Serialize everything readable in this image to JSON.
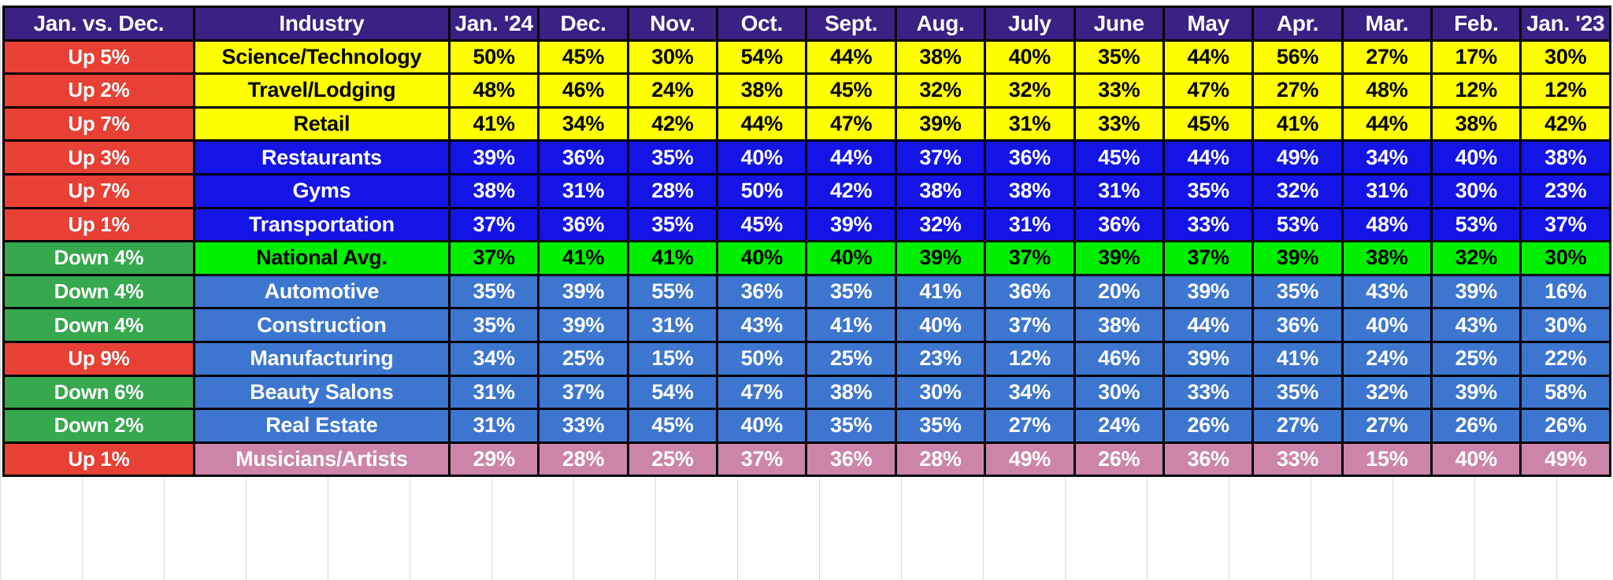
{
  "table": {
    "headers": {
      "change": "Jan. vs. Dec.",
      "industry": "Industry",
      "months": [
        "Jan. '24",
        "Dec.",
        "Nov.",
        "Oct.",
        "Sept.",
        "Aug.",
        "July",
        "June",
        "May",
        "Apr.",
        "Mar.",
        "Feb.",
        "Jan. '23"
      ]
    },
    "colors": {
      "header_bg": "#3b2183",
      "up_bg": "#e84034",
      "down_bg": "#36a94f",
      "band_yellow": "#ffff00",
      "band_blue": "#1414e6",
      "band_green": "#00f000",
      "band_steel": "#3d76d0",
      "band_pink": "#cc85a8"
    },
    "rows": [
      {
        "change": "Up 5%",
        "direction": "up",
        "industry": "Science/Technology",
        "band": "yellow",
        "values": [
          "50%",
          "45%",
          "30%",
          "54%",
          "44%",
          "38%",
          "40%",
          "35%",
          "44%",
          "56%",
          "27%",
          "17%",
          "30%"
        ]
      },
      {
        "change": "Up 2%",
        "direction": "up",
        "industry": "Travel/Lodging",
        "band": "yellow",
        "values": [
          "48%",
          "46%",
          "24%",
          "38%",
          "45%",
          "32%",
          "32%",
          "33%",
          "47%",
          "27%",
          "48%",
          "12%",
          "12%"
        ]
      },
      {
        "change": "Up 7%",
        "direction": "up",
        "industry": "Retail",
        "band": "yellow",
        "values": [
          "41%",
          "34%",
          "42%",
          "44%",
          "47%",
          "39%",
          "31%",
          "33%",
          "45%",
          "41%",
          "44%",
          "38%",
          "42%"
        ]
      },
      {
        "change": "Up 3%",
        "direction": "up",
        "industry": "Restaurants",
        "band": "blue",
        "values": [
          "39%",
          "36%",
          "35%",
          "40%",
          "44%",
          "37%",
          "36%",
          "45%",
          "44%",
          "49%",
          "34%",
          "40%",
          "38%"
        ]
      },
      {
        "change": "Up 7%",
        "direction": "up",
        "industry": "Gyms",
        "band": "blue",
        "values": [
          "38%",
          "31%",
          "28%",
          "50%",
          "42%",
          "38%",
          "38%",
          "31%",
          "35%",
          "32%",
          "31%",
          "30%",
          "23%"
        ]
      },
      {
        "change": "Up 1%",
        "direction": "up",
        "industry": "Transportation",
        "band": "blue",
        "values": [
          "37%",
          "36%",
          "35%",
          "45%",
          "39%",
          "32%",
          "31%",
          "36%",
          "33%",
          "53%",
          "48%",
          "53%",
          "37%"
        ]
      },
      {
        "change": "Down 4%",
        "direction": "down",
        "industry": "National Avg.",
        "band": "green",
        "values": [
          "37%",
          "41%",
          "41%",
          "40%",
          "40%",
          "39%",
          "37%",
          "39%",
          "37%",
          "39%",
          "38%",
          "32%",
          "30%"
        ]
      },
      {
        "change": "Down 4%",
        "direction": "down",
        "industry": "Automotive",
        "band": "steel",
        "values": [
          "35%",
          "39%",
          "55%",
          "36%",
          "35%",
          "41%",
          "36%",
          "20%",
          "39%",
          "35%",
          "43%",
          "39%",
          "16%"
        ]
      },
      {
        "change": "Down 4%",
        "direction": "down",
        "industry": "Construction",
        "band": "steel",
        "values": [
          "35%",
          "39%",
          "31%",
          "43%",
          "41%",
          "40%",
          "37%",
          "38%",
          "44%",
          "36%",
          "40%",
          "43%",
          "30%"
        ]
      },
      {
        "change": "Up 9%",
        "direction": "up",
        "industry": "Manufacturing",
        "band": "steel",
        "values": [
          "34%",
          "25%",
          "15%",
          "50%",
          "25%",
          "23%",
          "12%",
          "46%",
          "39%",
          "41%",
          "24%",
          "25%",
          "22%"
        ]
      },
      {
        "change": "Down 6%",
        "direction": "down",
        "industry": "Beauty Salons",
        "band": "steel",
        "values": [
          "31%",
          "37%",
          "54%",
          "47%",
          "38%",
          "30%",
          "34%",
          "30%",
          "33%",
          "35%",
          "32%",
          "39%",
          "58%"
        ]
      },
      {
        "change": "Down 2%",
        "direction": "down",
        "industry": "Real Estate",
        "band": "steel",
        "values": [
          "31%",
          "33%",
          "45%",
          "40%",
          "35%",
          "35%",
          "27%",
          "24%",
          "26%",
          "27%",
          "27%",
          "26%",
          "26%"
        ]
      },
      {
        "change": "Up 1%",
        "direction": "up",
        "industry": "Musicians/Artists",
        "band": "pink",
        "values": [
          "29%",
          "28%",
          "25%",
          "37%",
          "36%",
          "28%",
          "49%",
          "26%",
          "36%",
          "33%",
          "15%",
          "40%",
          "49%"
        ]
      }
    ]
  },
  "chart_data": {
    "type": "heatmap",
    "title": "Industry percentages by month with Jan. vs. Dec. change",
    "row_label_header": "Industry",
    "change_header": "Jan. vs. Dec.",
    "categories": [
      "Jan. '24",
      "Dec.",
      "Nov.",
      "Oct.",
      "Sept.",
      "Aug.",
      "July",
      "June",
      "May",
      "Apr.",
      "Mar.",
      "Feb.",
      "Jan. '23"
    ],
    "series": [
      {
        "name": "Science/Technology",
        "change": "Up 5%",
        "values": [
          50,
          45,
          30,
          54,
          44,
          38,
          40,
          35,
          44,
          56,
          27,
          17,
          30
        ]
      },
      {
        "name": "Travel/Lodging",
        "change": "Up 2%",
        "values": [
          48,
          46,
          24,
          38,
          45,
          32,
          32,
          33,
          47,
          27,
          48,
          12,
          12
        ]
      },
      {
        "name": "Retail",
        "change": "Up 7%",
        "values": [
          41,
          34,
          42,
          44,
          47,
          39,
          31,
          33,
          45,
          41,
          44,
          38,
          42
        ]
      },
      {
        "name": "Restaurants",
        "change": "Up 3%",
        "values": [
          39,
          36,
          35,
          40,
          44,
          37,
          36,
          45,
          44,
          49,
          34,
          40,
          38
        ]
      },
      {
        "name": "Gyms",
        "change": "Up 7%",
        "values": [
          38,
          31,
          28,
          50,
          42,
          38,
          38,
          31,
          35,
          32,
          31,
          30,
          23
        ]
      },
      {
        "name": "Transportation",
        "change": "Up 1%",
        "values": [
          37,
          36,
          35,
          45,
          39,
          32,
          31,
          36,
          33,
          53,
          48,
          53,
          37
        ]
      },
      {
        "name": "National Avg.",
        "change": "Down 4%",
        "values": [
          37,
          41,
          41,
          40,
          40,
          39,
          37,
          39,
          37,
          39,
          38,
          32,
          30
        ]
      },
      {
        "name": "Automotive",
        "change": "Down 4%",
        "values": [
          35,
          39,
          55,
          36,
          35,
          41,
          36,
          20,
          39,
          35,
          43,
          39,
          16
        ]
      },
      {
        "name": "Construction",
        "change": "Down 4%",
        "values": [
          35,
          39,
          31,
          43,
          41,
          40,
          37,
          38,
          44,
          36,
          40,
          43,
          30
        ]
      },
      {
        "name": "Manufacturing",
        "change": "Up 9%",
        "values": [
          34,
          25,
          15,
          50,
          25,
          23,
          12,
          46,
          39,
          41,
          24,
          25,
          22
        ]
      },
      {
        "name": "Beauty Salons",
        "change": "Down 6%",
        "values": [
          31,
          37,
          54,
          47,
          38,
          30,
          34,
          30,
          33,
          35,
          32,
          39,
          58
        ]
      },
      {
        "name": "Real Estate",
        "change": "Down 2%",
        "values": [
          31,
          33,
          45,
          40,
          35,
          35,
          27,
          24,
          26,
          27,
          27,
          26,
          26
        ]
      },
      {
        "name": "Musicians/Artists",
        "change": "Up 1%",
        "values": [
          29,
          28,
          25,
          37,
          36,
          28,
          49,
          26,
          36,
          33,
          15,
          40,
          49
        ]
      }
    ],
    "units": "percent",
    "grid": true,
    "legend": "none"
  }
}
